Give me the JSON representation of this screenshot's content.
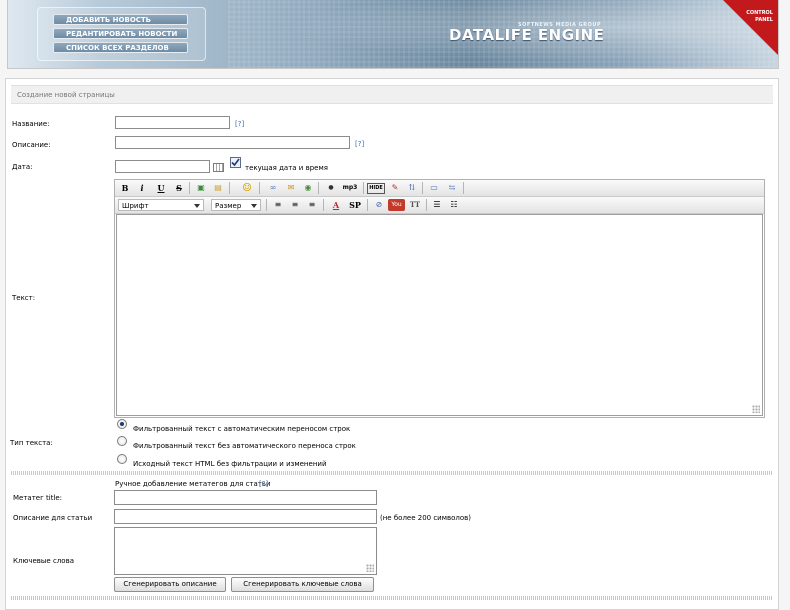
{
  "header": {
    "nav": [
      "ДОБАВИТЬ НОВОСТЬ",
      "РЕДАНТИРОВАТЬ НОВОСТИ",
      "СПИСОК ВСЕХ РАЗДЕЛОВ"
    ],
    "logo_sub": "SOFTNEWS MEDIA GROUP",
    "logo": "DATALIFE ENGINE",
    "control_panel": "CONTROL\nPANEL"
  },
  "section": {
    "title": "Создание новой страницы"
  },
  "form": {
    "name_label": "Название:",
    "desc_label": "Описание:",
    "date_label": "Дата:",
    "help": "[?]",
    "current_date_label": "текущая дата и время",
    "current_date_checked": true,
    "text_label": "Текст:",
    "font_select": "Шрифт",
    "size_select": "Размер",
    "text_type_label": "Тип текста:",
    "text_types": [
      {
        "label": "Фильтрованный текст с автоматическим переносом строк",
        "selected": true
      },
      {
        "label": "Фильтрованный текст без автоматического переноса строк",
        "selected": false
      },
      {
        "label": "Исходный текст HTML без фильтрации и изменений",
        "selected": false
      }
    ]
  },
  "meta": {
    "heading": "Ручное добавление метатегов для статьи",
    "help": "[?]",
    "title_label": "Метатег title:",
    "desc_label": "Описание для статьи",
    "desc_hint": "(не более 200 символов)",
    "keywords_label": "Ключевые слова",
    "gen_desc_button": "Сгенерировать описание",
    "gen_keywords_button": "Сгенерировать ключевые слова"
  },
  "toolbar1": [
    {
      "icon": "bold-icon",
      "glyph": "B"
    },
    {
      "icon": "italic-icon",
      "glyph": "i"
    },
    {
      "icon": "underline-icon",
      "glyph": "U"
    },
    {
      "icon": "strike-icon",
      "glyph": "S"
    },
    {
      "icon": "image-icon",
      "glyph": "▣"
    },
    {
      "icon": "folder-icon",
      "glyph": "▤"
    },
    {
      "icon": "smiley-icon",
      "glyph": "☺"
    },
    {
      "icon": "link-icon",
      "glyph": "∞"
    },
    {
      "icon": "email-link-icon",
      "glyph": "✉"
    },
    {
      "icon": "leech-icon",
      "glyph": "◉"
    },
    {
      "icon": "media-icon",
      "glyph": "●"
    },
    {
      "icon": "mp3-icon",
      "glyph": "mp3"
    },
    {
      "icon": "hide-icon",
      "glyph": "HIDE"
    },
    {
      "icon": "edit-icon",
      "glyph": "✎"
    },
    {
      "icon": "translit-icon",
      "glyph": "⇅"
    },
    {
      "icon": "page-break-icon",
      "glyph": "▭"
    },
    {
      "icon": "page-link-icon",
      "glyph": "⇆"
    }
  ],
  "toolbar2": [
    {
      "icon": "align-left-icon",
      "glyph": "≡"
    },
    {
      "icon": "align-center-icon",
      "glyph": "≡"
    },
    {
      "icon": "align-right-icon",
      "glyph": "≡"
    },
    {
      "icon": "text-color-icon",
      "glyph": "A"
    },
    {
      "icon": "spoiler-icon",
      "glyph": "SP"
    },
    {
      "icon": "flash-icon",
      "glyph": "⊘"
    },
    {
      "icon": "youtube-icon",
      "glyph": "You"
    },
    {
      "icon": "typograph-icon",
      "glyph": "TT"
    },
    {
      "icon": "bullet-list-icon",
      "glyph": "☰"
    },
    {
      "icon": "numbered-list-icon",
      "glyph": "☷"
    }
  ],
  "colors": {
    "accent_red": "#c2191c",
    "link_blue": "#3b6db6"
  }
}
